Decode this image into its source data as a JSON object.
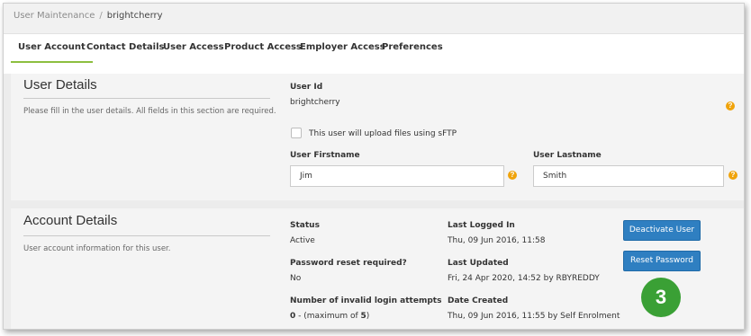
{
  "breadcrumb": {
    "parent": "User Maintenance",
    "separator": "/",
    "current": "brightcherry"
  },
  "tabs": [
    {
      "label": "User Account",
      "active": true
    },
    {
      "label": "Contact Details",
      "active": false
    },
    {
      "label": "User Access",
      "active": false
    },
    {
      "label": "Product Access",
      "active": false
    },
    {
      "label": "Employer Access",
      "active": false
    },
    {
      "label": "Preferences",
      "active": false
    }
  ],
  "user_details": {
    "title": "User Details",
    "description": "Please fill in the user details. All fields in this section are required.",
    "user_id_label": "User Id",
    "user_id_value": "brightcherry",
    "sftp_label": "This user will upload files using sFTP",
    "sftp_checked": false,
    "firstname_label": "User Firstname",
    "firstname_value": "Jim",
    "lastname_label": "User Lastname",
    "lastname_value": "Smith",
    "help_glyph": "?"
  },
  "account_details": {
    "title": "Account Details",
    "description": "User account information for this user.",
    "status_label": "Status",
    "status_value": "Active",
    "reset_required_label": "Password reset required?",
    "reset_required_value": "No",
    "invalid_attempts_label": "Number of invalid login attempts",
    "invalid_attempts_count": "0",
    "invalid_attempts_prefix": " - (maximum of ",
    "invalid_attempts_max": "5",
    "invalid_attempts_suffix": ")",
    "last_logged_in_label": "Last Logged In",
    "last_logged_in_value": "Thu, 09 Jun 2016, 11:58",
    "last_updated_label": "Last Updated",
    "last_updated_value": "Fri, 24 Apr 2020, 14:52 by RBYREDDY",
    "date_created_label": "Date Created",
    "date_created_value": "Thu, 09 Jun 2016, 11:55 by Self Enrolment",
    "deactivate_button": "Deactivate User",
    "reset_password_button": "Reset Password"
  },
  "step_badge": "3",
  "colors": {
    "tab_active_underline": "#8cbf3f",
    "button_blue": "#2f7fc1",
    "help_orange": "#f0a30a",
    "badge_green": "#3aa035"
  }
}
